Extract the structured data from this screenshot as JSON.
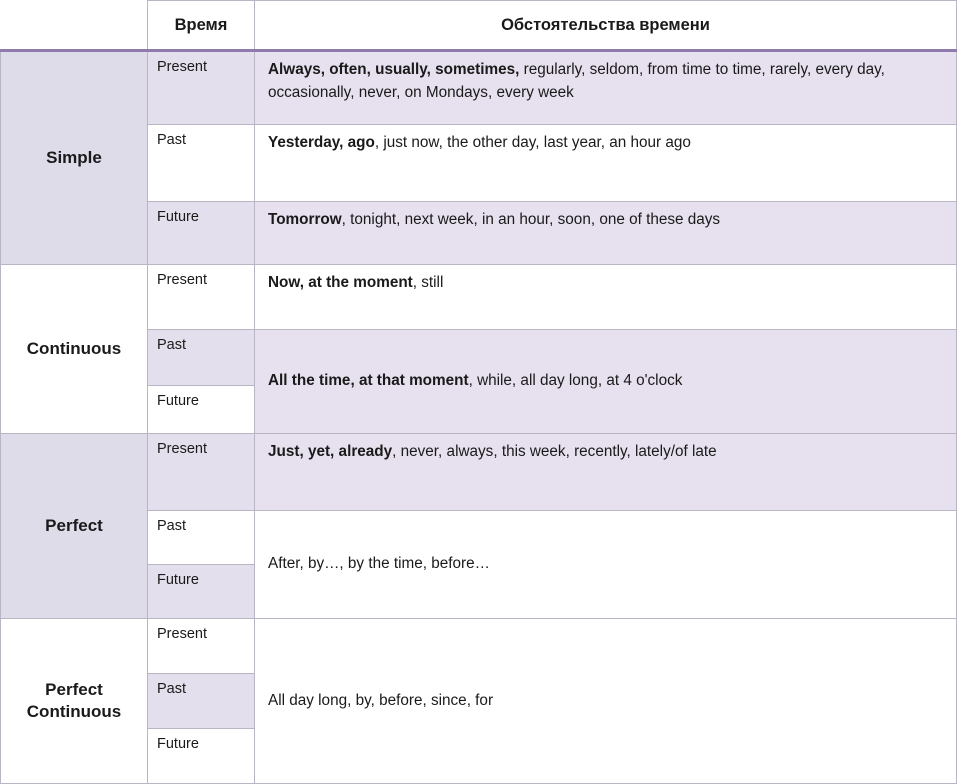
{
  "table": {
    "header": {
      "corner": "",
      "tense_col": "Время",
      "adverbs_col": "Обстоятельства времени"
    },
    "colors": {
      "accent_border": "#8f7aad",
      "grid_border": "#b9b5c4",
      "lavender": "#dfdcea",
      "lavender_light": "#e3dfec",
      "pink_lavender": "#e7e0ee",
      "white": "#ffffff",
      "text": "#1a1a1a"
    },
    "tense_labels": {
      "present": "Present",
      "past": "Past",
      "future": "Future"
    },
    "sections": [
      {
        "aspect": "Simple",
        "rows": {
          "present": {
            "bold": "Always, often, usually, sometimes,",
            "rest": " regularly, seldom, from time to time, rarely, every day, occasionally, never, on Mondays, every week"
          },
          "past": {
            "bold": "Yesterday, ago",
            "rest": ", just now, the other day, last year, an hour ago"
          },
          "future": {
            "bold": "Tomorrow",
            "rest": ", tonight, next week, in an hour, soon, one of these days"
          }
        }
      },
      {
        "aspect": "Continuous",
        "rows": {
          "present": {
            "bold": "Now, at the moment",
            "rest": ", still"
          },
          "past_future_merged": {
            "bold": "All the time, at that moment",
            "rest": ", while, all day long, at 4 o'clock"
          }
        }
      },
      {
        "aspect": "Perfect",
        "rows": {
          "present": {
            "bold": "Just, yet, already",
            "rest": ", never, always, this week, recently, lately/of late"
          },
          "past_future_merged": {
            "bold": "",
            "rest": "After, by…, by the time, before…"
          }
        }
      },
      {
        "aspect": "Perfect Continuous",
        "rows": {
          "all_merged": {
            "bold": "",
            "rest": "All day long, by, before, since, for"
          }
        }
      }
    ]
  }
}
